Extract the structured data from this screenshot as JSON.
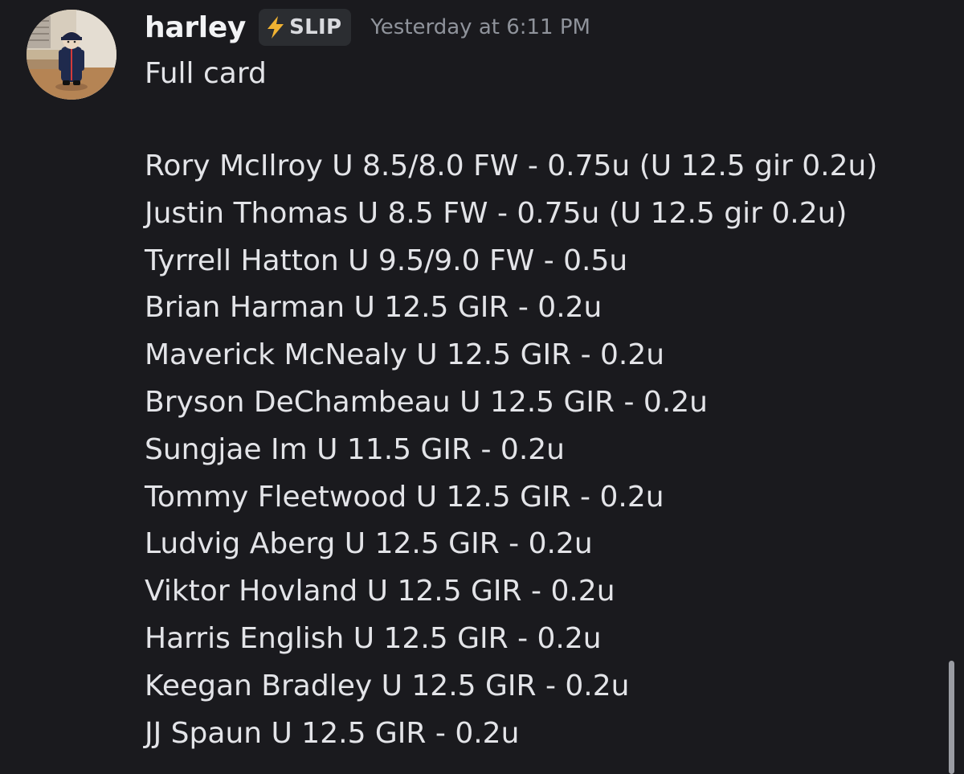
{
  "message": {
    "author": "harley",
    "tag": {
      "icon": "lightning-bolt-icon",
      "label": "SLIP"
    },
    "timestamp": "Yesterday at 6:11 PM",
    "intro": "Full card",
    "lines": [
      "Rory McIlroy U 8.5/8.0 FW - 0.75u (U 12.5 gir 0.2u)",
      "Justin Thomas U 8.5 FW - 0.75u (U 12.5 gir 0.2u)",
      "Tyrrell Hatton U 9.5/9.0 FW - 0.5u",
      "Brian Harman U 12.5 GIR - 0.2u",
      "Maverick McNealy U 12.5 GIR - 0.2u",
      "Bryson DeChambeau U 12.5 GIR - 0.2u",
      "Sungjae Im U 11.5 GIR - 0.2u",
      "Tommy Fleetwood U 12.5 GIR - 0.2u",
      "Ludvig Aberg U 12.5 GIR - 0.2u",
      "Viktor Hovland U 12.5 GIR - 0.2u",
      "Harris English U 12.5 GIR - 0.2u",
      "Keegan Bradley U 12.5 GIR - 0.2u",
      "JJ Spaun U 12.5 GIR - 0.2u"
    ]
  },
  "colors": {
    "background": "#1a1a1e",
    "text": "#e3e4e8",
    "username": "#f2f3f5",
    "timestamp": "#8f939b",
    "tag_background": "#2b2d31",
    "tag_icon": "#f0b232"
  }
}
